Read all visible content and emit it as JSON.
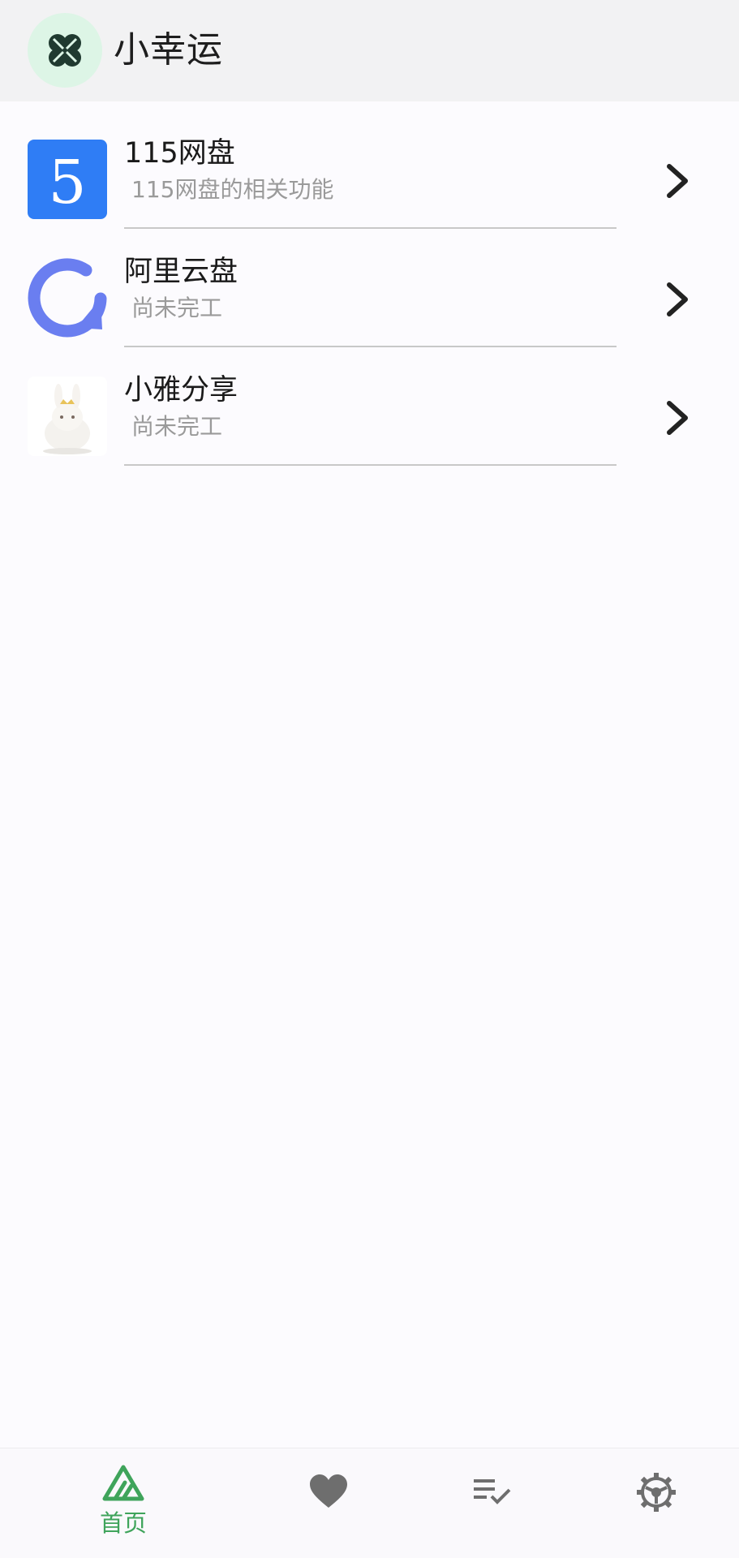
{
  "header": {
    "title": "小幸运",
    "logo_icon": "four-leaf-clover-icon"
  },
  "list": {
    "items": [
      {
        "title": "115网盘",
        "subtitle": "115网盘的相关功能",
        "icon": "115-cloud-logo"
      },
      {
        "title": "阿里云盘",
        "subtitle": "尚未完工",
        "icon": "aliyun-drive-logo"
      },
      {
        "title": "小雅分享",
        "subtitle": "尚未完工",
        "icon": "bunny-avatar"
      }
    ]
  },
  "bottom_nav": {
    "items": [
      {
        "label": "首页",
        "icon": "home-mountain-icon",
        "active": true
      },
      {
        "label": "",
        "icon": "heart-icon",
        "active": false
      },
      {
        "label": "",
        "icon": "checklist-icon",
        "active": false
      },
      {
        "label": "",
        "icon": "settings-gear-icon",
        "active": false
      }
    ]
  },
  "colors": {
    "accent": "#3FA45B",
    "logo_bg": "#DDF5E6",
    "icon_115": "#2F7DF5",
    "icon_aliyun": "#6A7EF0"
  }
}
